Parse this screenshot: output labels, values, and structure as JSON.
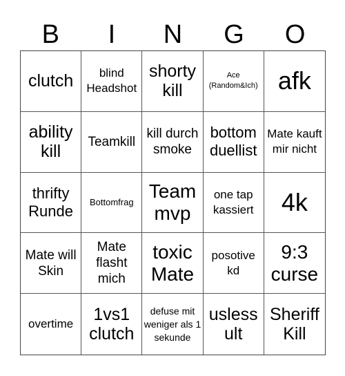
{
  "header": {
    "letters": [
      "B",
      "I",
      "N",
      "G",
      "O"
    ]
  },
  "board": {
    "cells": [
      {
        "text": "clutch",
        "size": "s-ml"
      },
      {
        "text": "blind Headshot",
        "size": "s-s"
      },
      {
        "text": "shorty kill",
        "size": "s-ml"
      },
      {
        "text": "Ace (Random&Ich)",
        "size": "s-tiny"
      },
      {
        "text": "afk",
        "size": "s-xl"
      },
      {
        "text": "ability kill",
        "size": "s-ml"
      },
      {
        "text": "Teamkill",
        "size": "s-sm"
      },
      {
        "text": "kill durch smoke",
        "size": "s-sm"
      },
      {
        "text": "bottom duellist",
        "size": "s-m"
      },
      {
        "text": "Mate kauft mir nicht",
        "size": "s-s"
      },
      {
        "text": "thrifty Runde",
        "size": "s-m"
      },
      {
        "text": "Bottomfrag",
        "size": "s-xxs"
      },
      {
        "text": "Team mvp",
        "size": "s-l"
      },
      {
        "text": "one tap kassiert",
        "size": "s-s"
      },
      {
        "text": "4k",
        "size": "s-xl"
      },
      {
        "text": "Mate will Skin",
        "size": "s-sm"
      },
      {
        "text": "Mate flasht mich",
        "size": "s-sm"
      },
      {
        "text": "toxic Mate",
        "size": "s-l"
      },
      {
        "text": "posotive kd",
        "size": "s-s"
      },
      {
        "text": "9:3 curse",
        "size": "s-l"
      },
      {
        "text": "overtime",
        "size": "s-s"
      },
      {
        "text": "1vs1 clutch",
        "size": "s-ml"
      },
      {
        "text": "defuse mit weniger als 1 sekunde",
        "size": "s-xs"
      },
      {
        "text": "usless ult",
        "size": "s-ml"
      },
      {
        "text": "Sheriff Kill",
        "size": "s-ml"
      }
    ]
  }
}
